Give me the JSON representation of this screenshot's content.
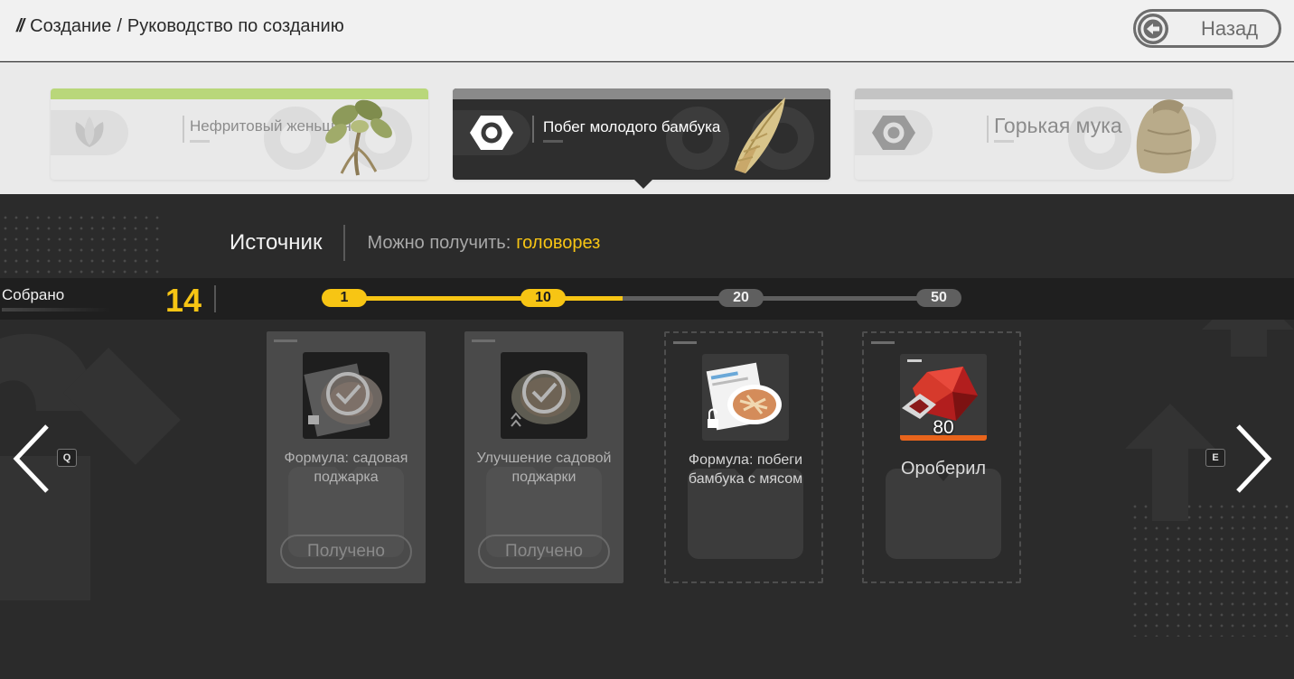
{
  "header": {
    "breadcrumb_1": "Создание",
    "breadcrumb_2": "Руководство по созданию",
    "back_label": "Назад"
  },
  "tabs": [
    {
      "label": "Нефритовый женьшень",
      "accent": "#b9d77a"
    },
    {
      "label": "Побег молодого бамбука",
      "accent": "#8a8a8a"
    },
    {
      "label": "Горькая мука",
      "accent": "#c4c4c4"
    }
  ],
  "source": {
    "title": "Источник",
    "prefix": "Можно получить:",
    "value": "головорез"
  },
  "collection": {
    "label": "Собрано",
    "count": "14",
    "progress": 14,
    "milestones": [
      {
        "label": "1",
        "reached": true
      },
      {
        "label": "10",
        "reached": true
      },
      {
        "label": "20",
        "reached": false
      },
      {
        "label": "50",
        "reached": false
      }
    ]
  },
  "nav": {
    "prev_key": "Q",
    "next_key": "E"
  },
  "rewards": [
    {
      "title": "Формула: садовая поджарка",
      "status": "Получено"
    },
    {
      "title": "Улучшение садовой поджарки",
      "status": "Получено"
    },
    {
      "title": "Формула: побеги бамбука с мясом"
    },
    {
      "title": "Ороберил",
      "count": "80"
    }
  ],
  "colors": {
    "accent_yellow": "#f7c514",
    "panel_dark": "#2b2b2b",
    "header_light": "#f1f1f1"
  }
}
